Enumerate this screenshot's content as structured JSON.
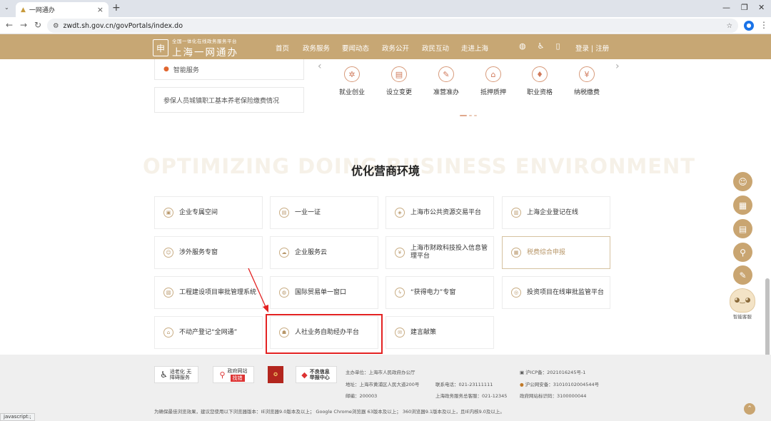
{
  "browser": {
    "tab_title": "一网通办",
    "url": "zwdt.sh.gov.cn/govPortals/index.do",
    "status_text": "javascript:;"
  },
  "header": {
    "logo_small": "全国一体化在线政务服务平台",
    "logo_big": "上海一网通办",
    "nav": [
      "首页",
      "政务服务",
      "要闻动态",
      "政务公开",
      "政民互动",
      "走进上海"
    ],
    "login": "登录",
    "divider": "|",
    "register": "注册"
  },
  "left_list": {
    "item_top": "智能服务",
    "item_bottom": "参保人员城镇职工基本养老保险缴费情况"
  },
  "services": [
    {
      "label": "就业创业",
      "icon": "briefcase-icon"
    },
    {
      "label": "设立变更",
      "icon": "document-icon"
    },
    {
      "label": "准营准办",
      "icon": "edit-icon"
    },
    {
      "label": "抵押质押",
      "icon": "house-icon"
    },
    {
      "label": "职业资格",
      "icon": "certificate-icon"
    },
    {
      "label": "纳税缴费",
      "icon": "yuan-icon"
    }
  ],
  "section": {
    "watermark": "OPTIMIZING DOING BUSINESS ENVIRONMENT",
    "title": "优化营商环境"
  },
  "cards": [
    "企业专属空间",
    "一业一证",
    "上海市公共资源交易平台",
    "上海企业登记在线",
    "涉外服务专窗",
    "企业服务云",
    "上海市财政科技投入信息管理平台",
    "税费综合申报",
    "工程建设项目审批管理系统",
    "国际贸易单一窗口",
    "“获得电力”专窗",
    "投资项目在线审批监管平台",
    "不动产登记“全网通”",
    "人社业务自助经办平台",
    "建言献策"
  ],
  "side_tools": {
    "robot_label": "智能客服"
  },
  "footer": {
    "logo1": "适老化 无障碍服务",
    "logo2_top": "政府网站",
    "logo2_bottom": "找错",
    "logo4": "不良信息 举报中心",
    "sponsor": "主办单位：上海市人民政府办公厅",
    "address": "地址：上海市黄浦区人民大道200号",
    "postcode": "邮编：200003",
    "phone": "联系电话：021-23111111",
    "hotline": "上海政务服务总客服：021-12345",
    "icp": "沪ICP备：2021016245号-1",
    "police": "沪公网安备：31010102004544号",
    "site_code": "政府网站标识码：3100000044",
    "browser_note": "为确保最佳浏览效果，建议您使用以下浏览器版本：IE浏览器9.0版本及以上； Google Chrome浏览器 63版本及以上； 360浏览器9.1版本及以上，且IE内核9.0及以上。"
  },
  "colors": {
    "brand": "#c7a774",
    "highlight": "#e32222"
  }
}
